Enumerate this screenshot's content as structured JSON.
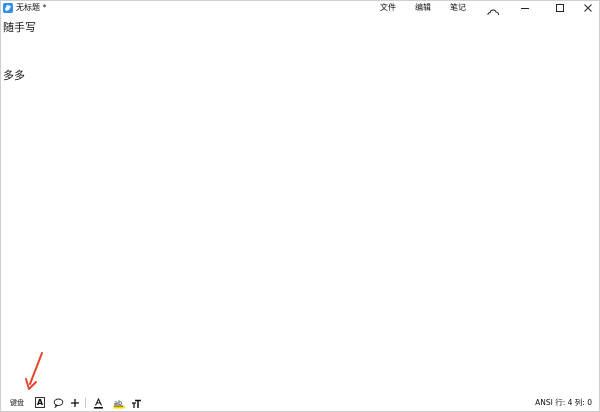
{
  "window": {
    "title": "无标题 *",
    "menu": [
      "文件",
      "编辑",
      "笔记"
    ]
  },
  "editor": {
    "lines": [
      "随手写",
      "",
      "",
      "多多"
    ]
  },
  "toolbar": {
    "keyboard_label": "键盘",
    "text_tool_label": "A",
    "status": "ANSI  行: 4  列: 0"
  },
  "colors": {
    "app_icon": "#2f8ff0",
    "annotation_arrow": "#e8452c",
    "highlight": "#f2d600"
  }
}
